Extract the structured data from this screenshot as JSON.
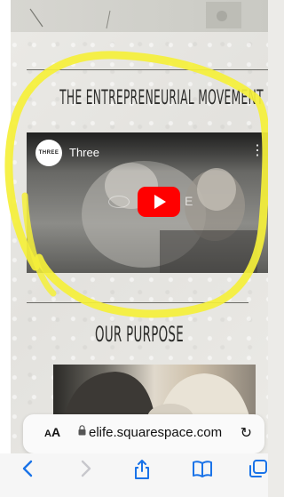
{
  "content": {
    "heading_movement": "THE ENTREPRENEURIAL MOVEMENT",
    "heading_purpose": "OUR PURPOSE"
  },
  "video": {
    "channel_logo_text": "THREE",
    "channel_name": "Three",
    "overlay_title": "E"
  },
  "browser": {
    "aa_label_small": "A",
    "aa_label_big": "A",
    "url": "elife.squarespace.com"
  },
  "colors": {
    "highlight": "#f5f03a",
    "yt_red": "#ff0000",
    "link_blue": "#1a73e8"
  },
  "icons": {
    "menu": "kebab-icon",
    "play": "youtube-play-icon",
    "lock": "lock-icon",
    "reload": "reload-icon",
    "back": "chevron-left-icon",
    "forward": "chevron-right-icon",
    "share": "share-icon",
    "bookmarks": "book-icon",
    "tabs": "tabs-icon"
  }
}
